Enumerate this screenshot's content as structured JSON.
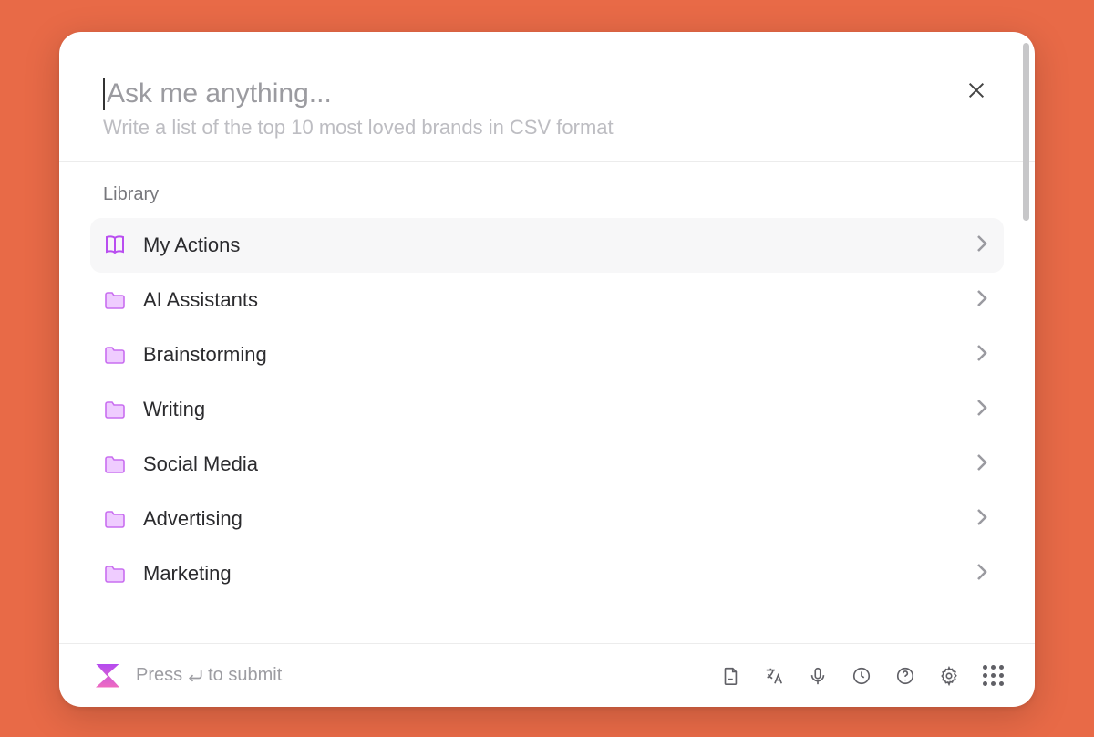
{
  "prompt": {
    "placeholder": "Ask me anything...",
    "example": "Write a list of the top 10 most loved brands in CSV format"
  },
  "library": {
    "title": "Library",
    "items": [
      {
        "label": "My Actions",
        "icon": "book",
        "selected": true
      },
      {
        "label": "AI Assistants",
        "icon": "folder",
        "selected": false
      },
      {
        "label": "Brainstorming",
        "icon": "folder",
        "selected": false
      },
      {
        "label": "Writing",
        "icon": "folder",
        "selected": false
      },
      {
        "label": "Social Media",
        "icon": "folder",
        "selected": false
      },
      {
        "label": "Advertising",
        "icon": "folder",
        "selected": false
      },
      {
        "label": "Marketing",
        "icon": "folder",
        "selected": false
      }
    ]
  },
  "footer": {
    "hint_prefix": "Press ",
    "hint_suffix": " to submit"
  }
}
